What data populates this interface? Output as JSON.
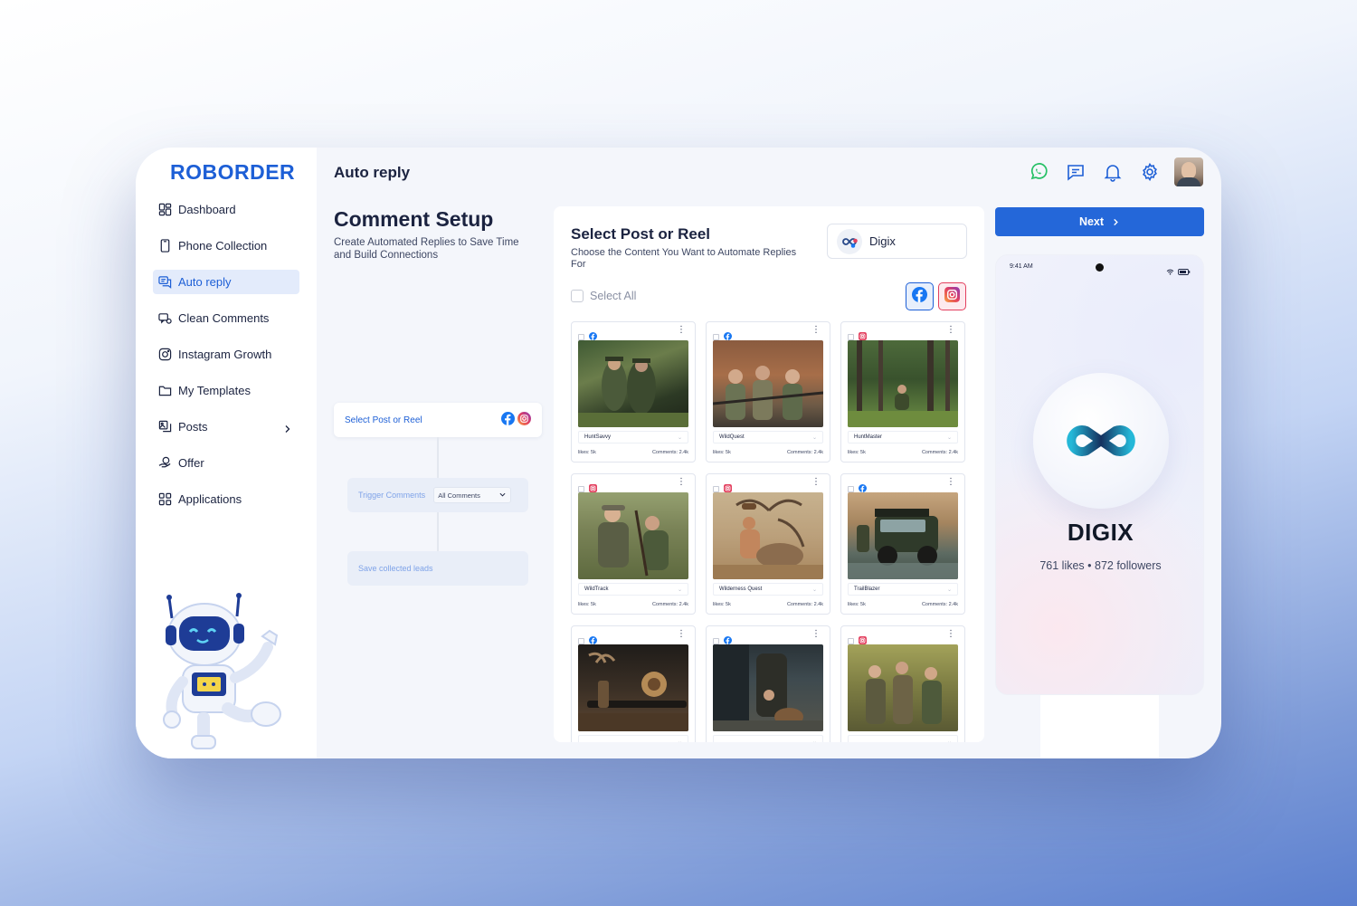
{
  "sidebar": {
    "logo": "ROBORDER",
    "items": [
      {
        "label": "Dashboard",
        "icon": "dashboard-icon"
      },
      {
        "label": "Phone Collection",
        "icon": "phone-icon"
      },
      {
        "label": "Auto reply",
        "icon": "chat-reply-icon",
        "active": true
      },
      {
        "label": "Clean Comments",
        "icon": "clean-comments-icon"
      },
      {
        "label": "Instagram Growth",
        "icon": "instagram-icon"
      },
      {
        "label": "My Templates",
        "icon": "folder-icon"
      },
      {
        "label": "Posts",
        "icon": "posts-icon",
        "has_submenu": true
      },
      {
        "label": "Offer",
        "icon": "offer-icon"
      },
      {
        "label": "Applications",
        "icon": "applications-grid-icon"
      }
    ]
  },
  "header": {
    "title": "Auto reply",
    "icons": [
      "whatsapp-icon",
      "message-icon",
      "bell-icon",
      "settings-icon"
    ]
  },
  "comment_setup": {
    "title": "Comment Setup",
    "subtitle": "Create Automated Replies to Save Time and Build Connections",
    "flow": {
      "step1": "Select Post or Reel",
      "step2_label": "Trigger Comments",
      "step2_select": "All Comments",
      "step3": "Save collected leads"
    }
  },
  "panel": {
    "title": "Select Post or Reel",
    "subtitle": "Choose the Content You Want to Automate Replies For",
    "account": "Digix",
    "select_all": "Select All",
    "posts": [
      {
        "name": "HuntSavvy",
        "likes": "likes: 5k",
        "comments": "Comments: 2.4k",
        "platform": "facebook"
      },
      {
        "name": "WildQuest",
        "likes": "likes: 5k",
        "comments": "Comments: 2.4k",
        "platform": "facebook"
      },
      {
        "name": "HuntMaster",
        "likes": "likes: 5k",
        "comments": "Comments: 2.4k",
        "platform": "instagram"
      },
      {
        "name": "WildTrack",
        "likes": "likes: 5k",
        "comments": "Comments: 2.4k",
        "platform": "instagram"
      },
      {
        "name": "Wilderness Quest",
        "likes": "likes: 5k",
        "comments": "Comments: 2.4k",
        "platform": "instagram"
      },
      {
        "name": "TrailBlazer",
        "likes": "likes: 5k",
        "comments": "Comments: 2.4k",
        "platform": "facebook"
      },
      {
        "name": "",
        "likes": "",
        "comments": "",
        "platform": "facebook"
      },
      {
        "name": "",
        "likes": "",
        "comments": "",
        "platform": "facebook"
      },
      {
        "name": "",
        "likes": "",
        "comments": "",
        "platform": "instagram"
      }
    ]
  },
  "preview": {
    "next_label": "Next",
    "time": "9:41 AM",
    "brand": "DIGIX",
    "stats": "761 likes • 872 followers"
  },
  "colors": {
    "accent": "#2467d9",
    "facebook": "#1877f2",
    "instagram": "#e3405f"
  }
}
